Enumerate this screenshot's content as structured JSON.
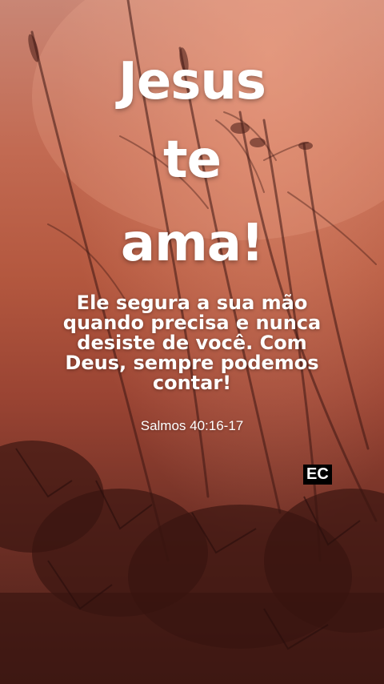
{
  "title": {
    "line1": "Jesus",
    "line2": "te",
    "line3": "ama!"
  },
  "message": {
    "line1": "Ele segura a sua mão",
    "line2": "quando precisa e nunca",
    "line3": "desiste de você. Com",
    "line4": "Deus, sempre podemos",
    "line5": "contar!"
  },
  "reference": "Salmos 40:16-17",
  "badge": "EC",
  "colors": {
    "sky_top": "#c98675",
    "sky_mid": "#b4583f",
    "ground": "#4a1f19",
    "text": "#ffffff"
  }
}
